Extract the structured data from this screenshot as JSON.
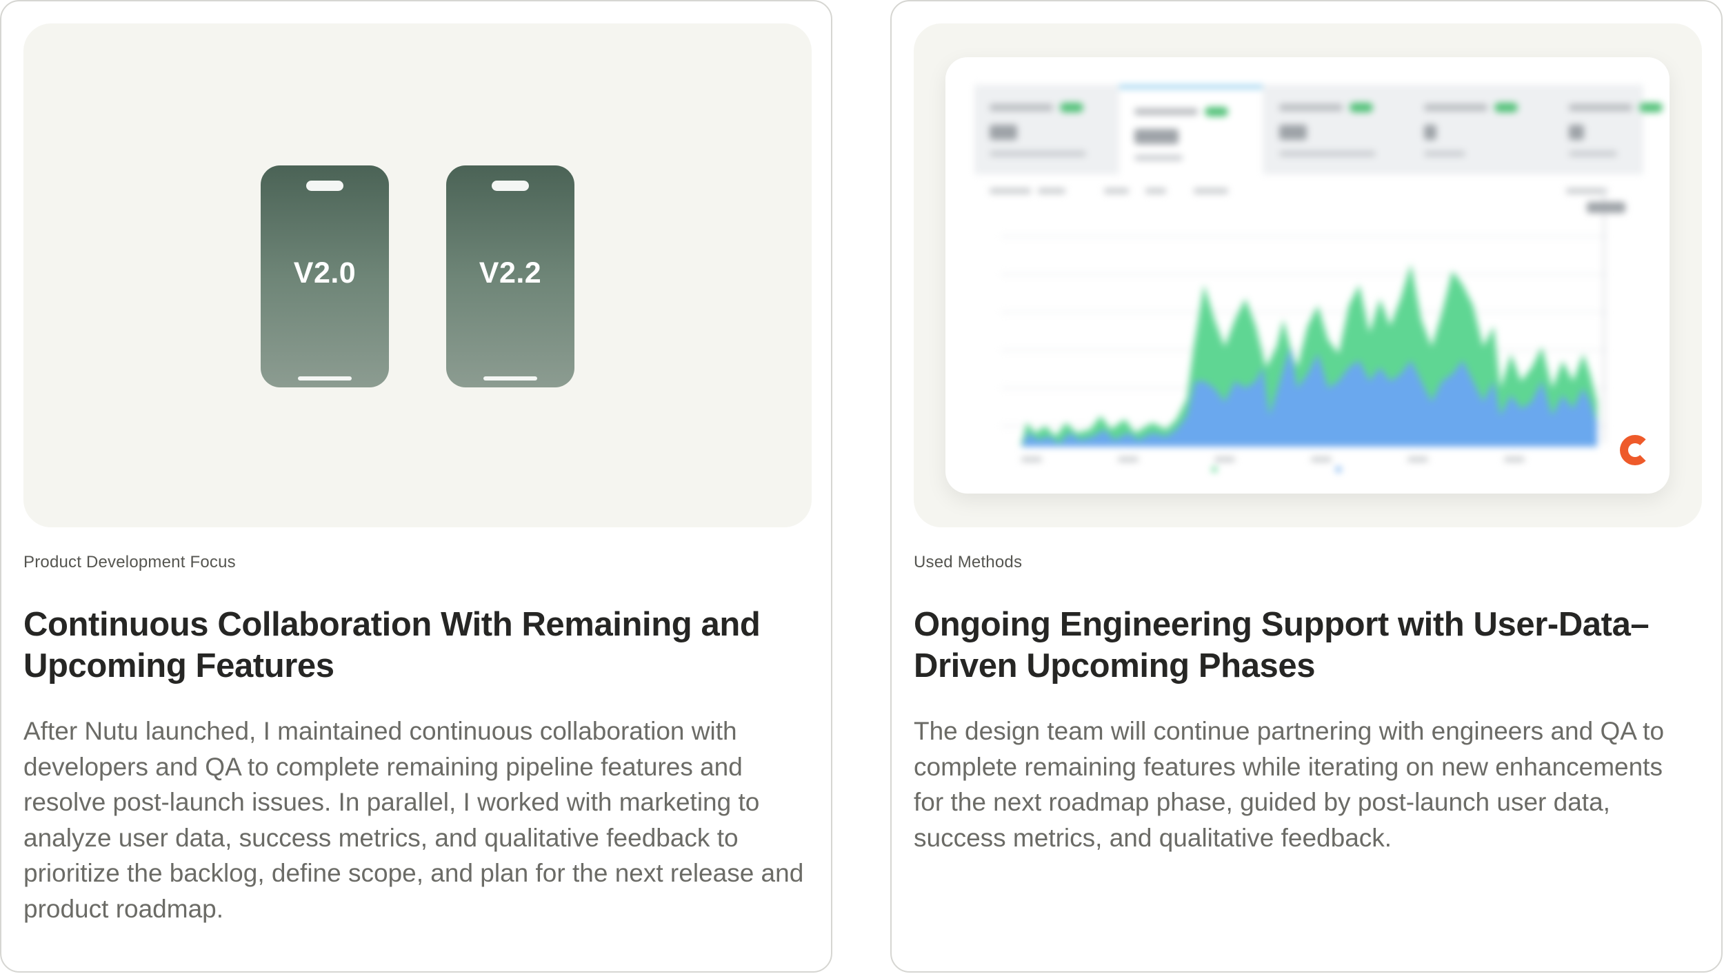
{
  "cards": [
    {
      "eyebrow": "Product Development Focus",
      "title": "Continuous Collaboration With Remaining and Upcoming Features",
      "body": "After Nutu launched, I maintained continuous collaboration with developers and QA to complete remaining pipeline features and resolve post-launch issues. In parallel, I worked with marketing to analyze user data, success metrics, and qualitative feedback to prioritize the backlog, define scope, and plan for the next release and product roadmap.",
      "media": {
        "phones": [
          {
            "version": "V2.0"
          },
          {
            "version": "V2.2"
          }
        ]
      }
    },
    {
      "eyebrow": "Used Methods",
      "title": "Ongoing Engineering Support with User-Data–Driven Upcoming Phases",
      "body": "The design team will continue partnering with engineers and QA to complete remaining features while iterating on new enhancements for the next roadmap phase, guided by post-launch user data, success metrics, and qualitative feedback.",
      "media": {
        "dashboard": {
          "blurred": true,
          "series_colors": {
            "primary": "#6aa8ee",
            "secondary": "#5fd693"
          },
          "logo_color": "#ee5a2a",
          "chart_type": "area"
        }
      }
    }
  ],
  "colors": {
    "card_border": "#d6d6d2",
    "media_bg": "#f5f5f0",
    "phone_top": "#4b6356",
    "phone_bottom": "#8c9c91",
    "title": "#262624",
    "body": "#6b6b66"
  }
}
